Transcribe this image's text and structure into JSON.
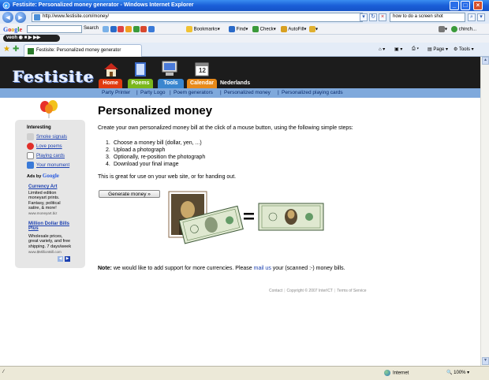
{
  "window": {
    "title": "Festisite: Personalized money generator - Windows Internet Explorer"
  },
  "address_bar": {
    "url": "http://www.festisite.com/money/",
    "search_value": "how to do a screen shot"
  },
  "google_toolbar": {
    "logo": "Google",
    "search_label": "Search",
    "bookmarks_label": "Bookmarks",
    "find_label": "Find",
    "check_label": "Check",
    "autofill_label": "AutoFill",
    "user_label": "chinch..."
  },
  "veoh_toolbar": {
    "logo": "veoh"
  },
  "tab_bar": {
    "tab_title": "Festisite: Personalized money generator",
    "page_label": "Page",
    "tools_label": "Tools"
  },
  "site": {
    "logo": "Festisite",
    "nav": [
      "Home",
      "Poems",
      "Tools",
      "Calendar"
    ],
    "calendar_day": "12",
    "language": "Nederlands",
    "subnav": [
      "Party Printer",
      "Party Logo",
      "Poem generators",
      "Personalized money",
      "Personalized playing cards"
    ]
  },
  "sidebar": {
    "heading": "Interesting",
    "links": [
      {
        "label": "Smoke signals",
        "icon": "smoke-icon"
      },
      {
        "label": "Love poems",
        "icon": "heart-icon"
      },
      {
        "label": "Playing cards",
        "icon": "cards-icon"
      },
      {
        "label": "Your monument",
        "icon": "monument-icon"
      }
    ],
    "ads_by": "Ads by",
    "ads_by_brand": "Google",
    "ads": [
      {
        "title": "Currency Art",
        "lines": [
          "Limited edition",
          "moneyart prints.",
          "Fantasy, political",
          "satire, & more!"
        ],
        "url": "www.moneyart.biz"
      },
      {
        "title": "Million Dollar Bills Plus",
        "lines": [
          "Wholesale prices,",
          "great variety, and free",
          "shipping. 7 days/week"
        ],
        "url": "www.$MillionBill.com"
      }
    ]
  },
  "main": {
    "title": "Personalized money",
    "intro": "Create your own personalized money bill at the click of a mouse button, using the following simple steps:",
    "steps": [
      "Choose a money bill (dollar, yen, ...)",
      "Upload a photograph",
      "Optionally, re-position the photograph",
      "Download your final image"
    ],
    "great": "This is great for use on your web site, or for handing out.",
    "generate_button": "Generate money »",
    "equals": "=",
    "note_bold": "Note:",
    "note_text": " we would like to add support for more currencies. Please ",
    "note_link": "mail us",
    "note_text2": " your (scanned :-) money bills."
  },
  "footer": {
    "links": [
      "Contact",
      "Copyright © 2007 InterICT",
      "Terms of Service"
    ]
  },
  "status_bar": {
    "zone": "Internet",
    "zoom": "100%"
  },
  "colors": {
    "title_bar": "#1a5fd8",
    "nav_home": "#e03a10",
    "nav_poems": "#7ab71c",
    "nav_tools": "#3a86cf",
    "nav_calendar": "#e88a1a",
    "subnav": "#7fa9dc",
    "link": "#1a3fb0"
  }
}
